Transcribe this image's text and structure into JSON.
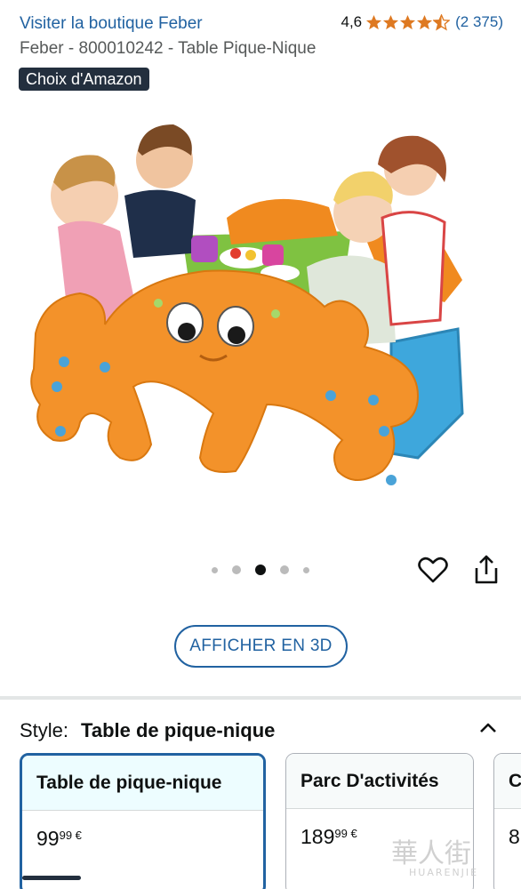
{
  "header": {
    "store_link": "Visiter la boutique Feber",
    "rating_value": "4,6",
    "rating_stars": 4.6,
    "rating_count": "(2 375)",
    "product_title": "Feber - 800010242 - Table Pique-Nique",
    "badge": "Choix d'Amazon"
  },
  "gallery": {
    "image_description_icon": "product-photo-picnic-table",
    "dot_count": 5,
    "active_dot": 3,
    "favorite_icon": "heart-icon",
    "share_icon": "share-icon"
  },
  "view_3d_button": "AFFICHER EN 3D",
  "style_selector": {
    "label": "Style:",
    "selected_value": "Table de pique-nique",
    "toggle_icon": "chevron-up-icon",
    "options": [
      {
        "name": "Table de pique-nique",
        "price_whole": "99",
        "price_cents": "99 €",
        "selected": true
      },
      {
        "name": "Parc D'activités",
        "price_whole": "189",
        "price_cents": "99 €",
        "selected": false
      },
      {
        "name": "C",
        "price_whole": "8",
        "price_cents": "",
        "selected": false
      }
    ]
  },
  "watermark": {
    "main": "華人街",
    "sub": "HUARENJIE"
  },
  "colors": {
    "link": "#2162a1",
    "star": "#de7921",
    "badge_bg": "#232f3e",
    "selected_border": "#2162a1"
  }
}
